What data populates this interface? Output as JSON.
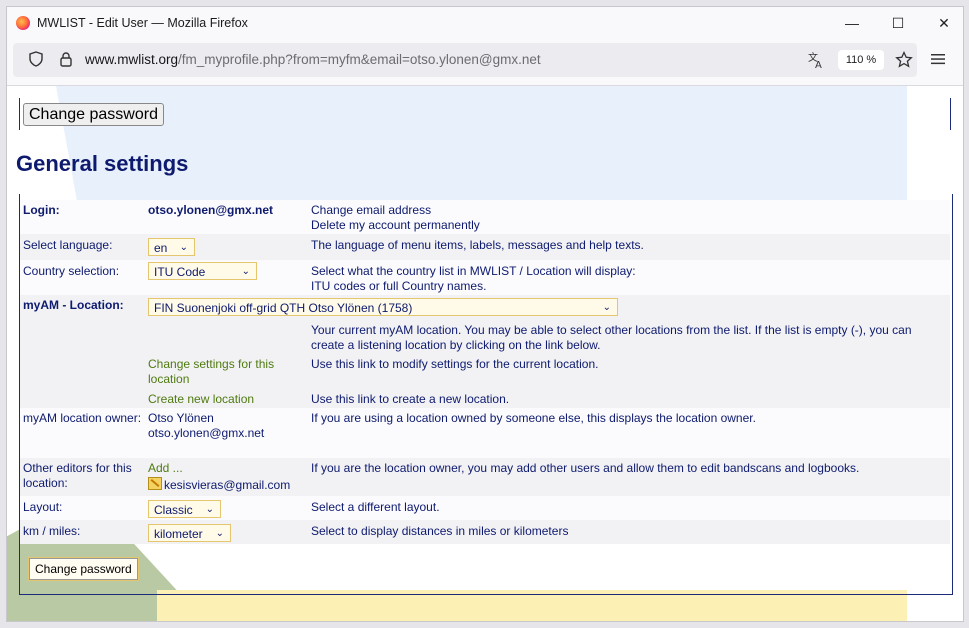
{
  "window": {
    "title": "MWLIST - Edit User — Mozilla Firefox",
    "controls": {
      "minimize": "—",
      "maximize": "☐",
      "close": "✕"
    }
  },
  "urlbar": {
    "domain": "www.mwlist.org",
    "path": "/fm_myprofile.php?from=myfm&email=otso.ylonen@gmx.net",
    "zoom": "110 %",
    "icons": [
      "shield-icon",
      "lock-icon",
      "translate-icon",
      "star-icon",
      "menu-icon"
    ]
  },
  "top_button": "Change password",
  "heading": "General settings",
  "rows": {
    "login": {
      "label": "Login:",
      "value": "otso.ylonen@gmx.net",
      "desc1": "Change email address",
      "desc2": "Delete my account permanently"
    },
    "language": {
      "label": "Select language:",
      "selected": "en",
      "desc": "The language of menu items, labels, messages and help texts."
    },
    "country": {
      "label": "Country selection:",
      "selected": "ITU Code",
      "desc1": "Select what the country list in MWLIST / Location will display:",
      "desc2": "ITU codes or full Country names."
    },
    "location": {
      "label": "myAM - Location:",
      "selected": "FIN Suonenjoki off-grid QTH Otso Ylönen (1758)",
      "desc1": "Your current myAM location. You may be able to select other locations from the list. If the list is empty (-), you can",
      "desc2": "create a listening location by clicking on the link below."
    },
    "change_settings": {
      "link1": "Change settings for this",
      "link2": "location",
      "desc": "Use this link to modify settings for the current location."
    },
    "create_location": {
      "link": "Create new location",
      "desc": "Use this link to create a new location."
    },
    "owner": {
      "label": "myAM location owner:",
      "name": "Otso Ylönen",
      "email": "otso.ylonen@gmx.net",
      "desc": "If you are using a location owned by someone else, this displays the location owner."
    },
    "editors": {
      "label1": "Other editors for this",
      "label2": "location:",
      "add": "Add ...",
      "editor": "kesisvieras@gmail.com",
      "desc": "If you are the location owner, you may add other users and allow them to edit bandscans and logbooks."
    },
    "layout": {
      "label": "Layout:",
      "selected": "Classic",
      "desc": "Select a different layout."
    },
    "distance": {
      "label": "km / miles:",
      "selected": "kilometer",
      "desc": "Select to display distances in miles or kilometers"
    }
  },
  "bottom_button": "Change password"
}
